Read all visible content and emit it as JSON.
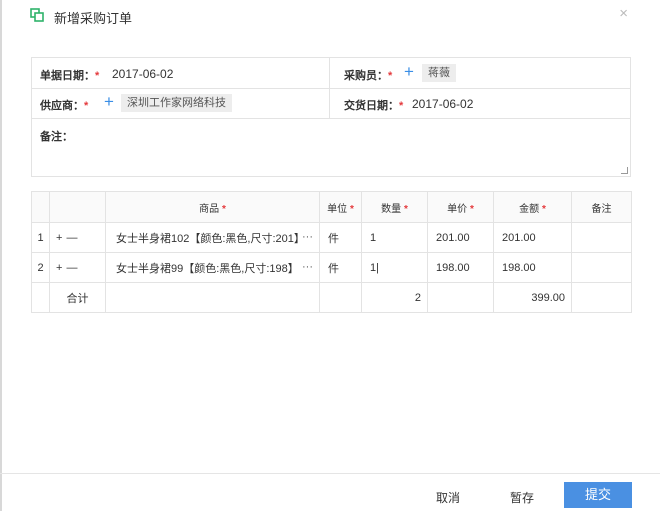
{
  "dialog": {
    "title": "新增采购订单",
    "close_glyph": "×"
  },
  "form": {
    "doc_date_label": "单据日期：",
    "doc_date": "2017-06-02",
    "buyer_label": "采购员：",
    "buyer": "蒋薇",
    "supplier_label": "供应商：",
    "supplier": "深圳工作家网络科技",
    "delivery_label": "交货日期：",
    "delivery_date": "2017-06-02",
    "remark_label": "备注：",
    "required_mark": "*",
    "add_glyph": "+"
  },
  "grid": {
    "headers": {
      "product": "商品",
      "unit": "单位",
      "qty": "数量",
      "price": "单价",
      "amount": "金额",
      "remark": "备注"
    },
    "ops": {
      "add": "+",
      "remove": "—"
    },
    "rows": [
      {
        "index": "1",
        "product": "女士半身裙102【颜色:黑色,尺寸:201】",
        "more": "···",
        "unit": "件",
        "qty": "1",
        "price": "201.00",
        "amount": "201.00"
      },
      {
        "index": "2",
        "product": "女士半身裙99【颜色:黑色,尺寸:198】",
        "more": "···",
        "unit": "件",
        "qty": "1|",
        "price": "198.00",
        "amount": "198.00"
      }
    ],
    "total": {
      "label": "合计",
      "qty": "2",
      "amount": "399.00"
    }
  },
  "footer": {
    "cancel": "取消",
    "save_draft": "暂存",
    "submit": "提交"
  },
  "colors": {
    "accent": "#4a90e2",
    "required": "#e4393c",
    "icon_green": "#2fb36a"
  }
}
